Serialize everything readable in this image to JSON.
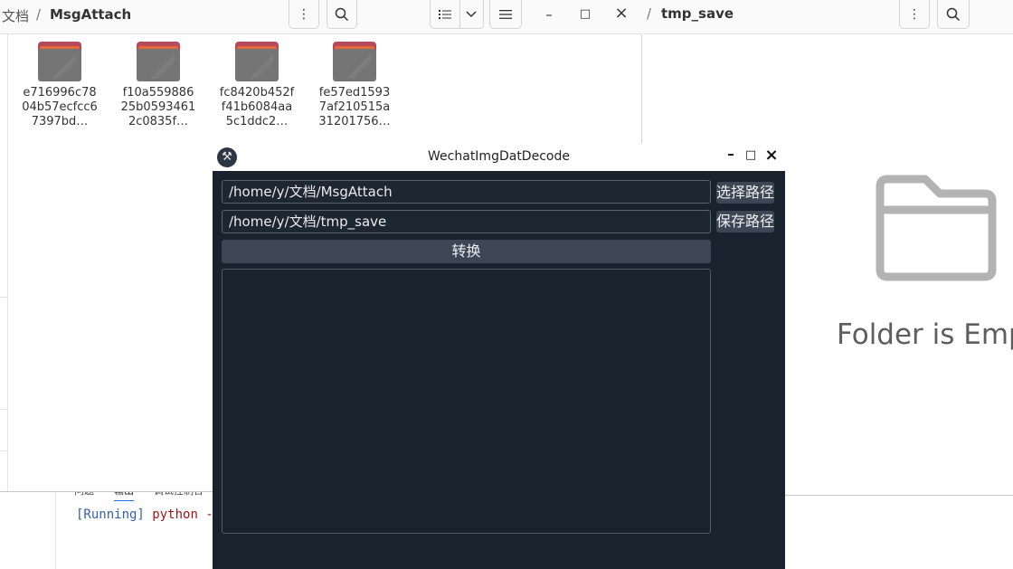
{
  "vscode_panel": {
    "tabs": [
      "问题",
      "输出",
      "调试控制台"
    ],
    "active_tab": "输出",
    "terminal_status": "[Running]",
    "terminal_command": "python -"
  },
  "left_window": {
    "breadcrumb_parent": "文档",
    "breadcrumb_separator": "/",
    "breadcrumb_current": "MsgAttach",
    "files": [
      {
        "name": "e716996c7804b57ecfcc67397bd…"
      },
      {
        "name": "f10a55988625b05934612c0835f…"
      },
      {
        "name": "fc8420b452ff41b6084aa5c1ddc2…"
      },
      {
        "name": "fe57ed15937af210515a31201756…"
      }
    ],
    "folder_color": "#757575",
    "folder_accent": "#b64a5c"
  },
  "right_window": {
    "breadcrumb_separator": "/",
    "breadcrumb_current": "tmp_save",
    "empty_message": "Folder is Emp"
  },
  "dialog": {
    "title": "WechatImgDatDecode",
    "source_path": "/home/y/文档/MsgAttach",
    "save_path": "/home/y/文档/tmp_save",
    "select_button": "选择路径",
    "save_button": "保存路径",
    "convert_button": "转换",
    "log_text": "",
    "background": "#1a222d",
    "button_color": "#3d4654"
  },
  "icons": {
    "more": "⋮",
    "search": "search-icon",
    "list_view": "list-view-icon",
    "dropdown": "chevron-down-icon",
    "menu": "hamburger-menu-icon",
    "minimize": "–",
    "maximize": "□",
    "close": "×",
    "app": "⚒"
  }
}
